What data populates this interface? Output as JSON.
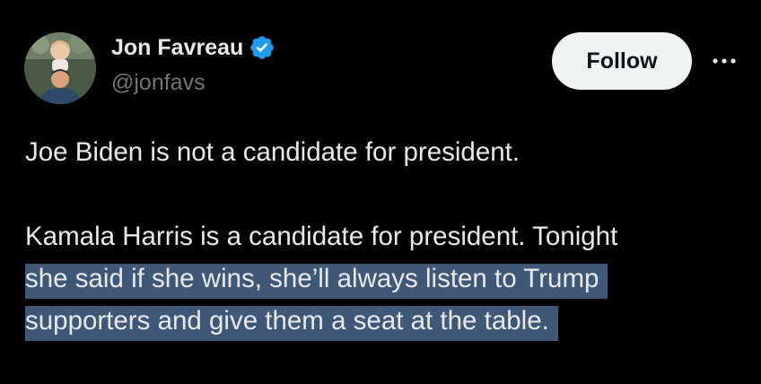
{
  "author": {
    "display_name": "Jon Favreau",
    "handle": "@jonfavs",
    "verified": true,
    "verified_color": "#1d9bf0"
  },
  "actions": {
    "follow_label": "Follow",
    "more_icon": "more-horizontal-icon"
  },
  "tweet": {
    "line1": "Joe Biden is not a candidate for president.",
    "line2": "Kamala Harris is a candidate for president. Tonight",
    "line3": "she said if she wins, she’ll always listen to Trump",
    "line4": "supporters and give them a seat at the table."
  },
  "colors": {
    "background": "#000000",
    "text": "#e7e9ea",
    "secondary_text": "#71767b",
    "selection_highlight": "#3f5878",
    "follow_button_bg": "#eff3f4"
  }
}
